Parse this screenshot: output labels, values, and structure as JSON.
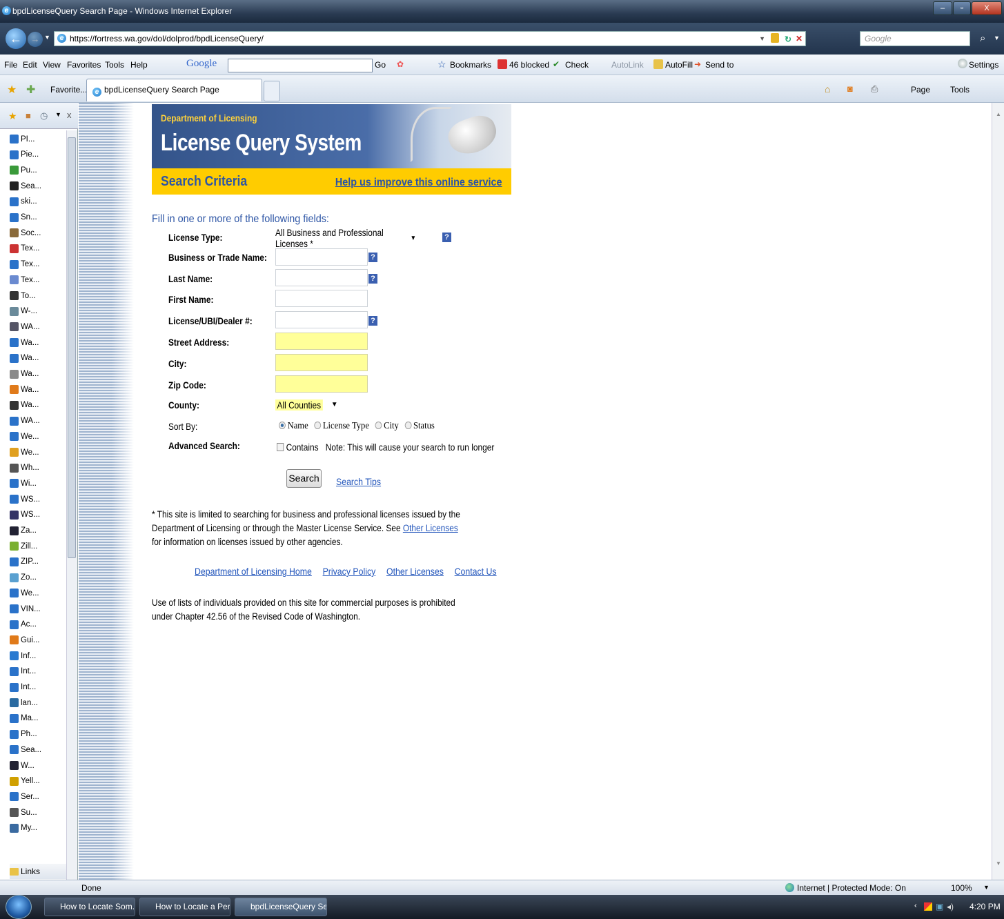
{
  "window": {
    "title": "bpdLicenseQuery Search Page - Windows Internet Explorer",
    "url": "https://fortress.wa.gov/dol/dolprod/bpdLicenseQuery/",
    "search_placeholder": "Google"
  },
  "menu": {
    "items": [
      "File",
      "Edit",
      "View",
      "Favorites",
      "Tools",
      "Help"
    ],
    "google_label": "Google",
    "go": "Go",
    "bookmarks": "Bookmarks",
    "blocked": "46 blocked",
    "check": "Check",
    "autolink": "AutoLink",
    "autofill": "AutoFill",
    "sendto": "Send to",
    "settings": "Settings"
  },
  "tabs": {
    "favorites": "Favorite...",
    "active_tab": "bpdLicenseQuery Search Page",
    "page": "Page",
    "tools": "Tools"
  },
  "sidebar": {
    "items": [
      "PI...",
      "Pie...",
      "Pu...",
      "Sea...",
      "ski...",
      "Sn...",
      "Soc...",
      "Tex...",
      "Tex...",
      "Tex...",
      "To...",
      "W-...",
      "WA...",
      "Wa...",
      "Wa...",
      "Wa...",
      "Wa...",
      "Wa...",
      "WA...",
      "We...",
      "We...",
      "Wh...",
      "Wi...",
      "WS...",
      "WS...",
      "Za...",
      "Zill...",
      "ZIP...",
      "Zo...",
      "We...",
      "VIN...",
      "Ac...",
      "Gui...",
      "Inf...",
      "Int...",
      "Int...",
      "lan...",
      "Ma...",
      "Ph...",
      "Sea...",
      "W...",
      "Yell...",
      "Ser...",
      "Su...",
      "My..."
    ],
    "links": "Links"
  },
  "banner": {
    "dept": "Department of Licensing",
    "title": "License Query System",
    "criteria": "Search Criteria",
    "help": "Help us improve this online service"
  },
  "form": {
    "instruction": "Fill in one or more of the following fields:",
    "license_type_label": "License Type:",
    "license_type_value": "All Business and Professional Licenses *",
    "business_label": "Business or Trade Name:",
    "last_label": "Last Name:",
    "first_label": "First Name:",
    "license_no_label": "License/UBI/Dealer #:",
    "street_label": "Street Address:",
    "city_label": "City:",
    "zip_label": "Zip Code:",
    "county_label": "County:",
    "county_value": "All Counties",
    "sort_label": "Sort By:",
    "sort_options": [
      "Name",
      "License Type",
      "City",
      "Status"
    ],
    "advanced_label": "Advanced Search:",
    "contains": "Contains",
    "note": "Note: This will cause your search to run longer",
    "search_button": "Search",
    "search_tips": "Search Tips"
  },
  "footer": {
    "disclaimer_1": "* This site is limited to searching for business and professional licenses issued by the Department of Licensing or through the Master License Service. See ",
    "disclaimer_link": "Other Licenses",
    "disclaimer_2": " for information on licenses issued by other agencies.",
    "links": [
      "Department of Licensing Home",
      "Privacy Policy",
      "Other Licenses",
      "Contact Us"
    ],
    "legal": "Use of lists of individuals provided on this site for commercial purposes is prohibited under Chapter 42.56 of the Revised Code of Washington."
  },
  "statusbar": {
    "done": "Done",
    "zone": "Internet | Protected Mode: On",
    "zoom": "100%"
  },
  "taskbar": {
    "tasks": [
      "How to Locate Som...",
      "How to Locate a Per...",
      "bpdLicenseQuery Se..."
    ],
    "time": "4:20 PM"
  },
  "colors": {
    "banner_blue": "#34548a",
    "criteria_yellow": "#ffcc00",
    "link_blue": "#2255bb",
    "highlight_field": "#ffff99"
  }
}
